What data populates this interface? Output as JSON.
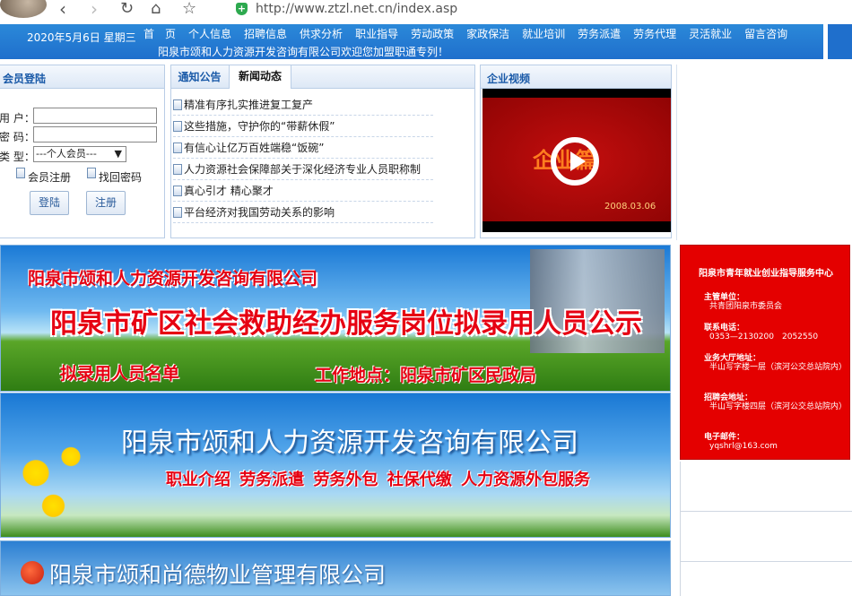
{
  "browser": {
    "url": "http://www.ztzl.net.cn/index.asp",
    "icons": [
      "back-icon",
      "forward-icon",
      "reload-icon",
      "home-icon",
      "star-icon",
      "shield-icon"
    ]
  },
  "header": {
    "date": "2020年5月6日 星期三",
    "nav": [
      "首　页",
      "个人信息",
      "招聘信息",
      "供求分析",
      "职业指导",
      "劳动政策",
      "家政保洁",
      "就业培训",
      "劳务派遣",
      "劳务代理",
      "灵活就业",
      "留言咨询"
    ],
    "marquee": "阳泉市颂和人力资源开发咨询有限公司欢迎您加盟职通专列！"
  },
  "login": {
    "title": "会员登陆",
    "user_label": "用 户：",
    "password_label": "密 码：",
    "type_label": "类 型：",
    "type_selected": "---个人会员---",
    "register_link": "会员注册",
    "recover_link": "找回密码",
    "login_button": "登陆",
    "register_button": "注册"
  },
  "news": {
    "tabs": [
      "通知公告",
      "新闻动态"
    ],
    "items": [
      "精准有序扎实推进复工复产",
      "这些措施，守护你的“带薪休假”",
      "有信心让亿万百姓端稳“饭碗”",
      "人力资源社会保障部关于深化经济专业人员职称制",
      "真心引才 精心聚才",
      "平台经济对我国劳动关系的影响"
    ]
  },
  "video": {
    "title": "企业视频",
    "screen_title": "企业篇",
    "screen_date": "2008.03.06"
  },
  "banners": {
    "b1_company": "阳泉市颂和人力资源开发咨询有限公司",
    "b1_title": "阳泉市矿区社会救助经办服务岗位拟录用人员公示",
    "b1_sub1": "拟录用人员名单",
    "b1_sub2": "工作地点：阳泉市矿区民政局",
    "b2_company": "阳泉市颂和人力资源开发咨询有限公司",
    "b2_services": "职业介绍  劳务派遣  劳务外包  社保代缴  人力资源外包服务",
    "b3_company": "阳泉市颂和尚德物业管理有限公司"
  },
  "redbox": {
    "title": "阳泉市青年就业创业指导服务中心",
    "org_label": "主管单位：",
    "org_value": "共青团阳泉市委员会",
    "phone_label": "联系电话：",
    "phone_value": "0353—2130200　2052550",
    "hall_label": "业务大厅地址：",
    "hall_value": "半山写字楼一层（滨河公交总站院内）",
    "recruit_label": "招聘会地址：",
    "recruit_value": "半山写字楼四层（滨河公交总站院内）",
    "email_label": "电子邮件：",
    "email_value": "yqshrl@163.com"
  }
}
